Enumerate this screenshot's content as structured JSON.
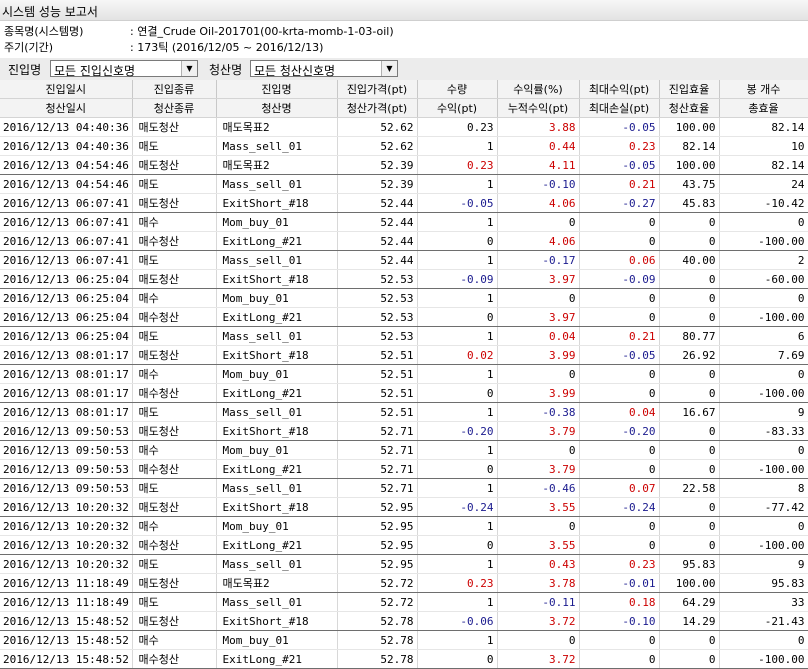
{
  "window": {
    "title": "시스템 성능 보고서"
  },
  "info": {
    "symbol_label": "종목명(시스템명)",
    "symbol_value": ": 연결_Crude Oil-201701(00-krta-momb-1-03-oil)",
    "period_label": "주기(기간)",
    "period_value": ": 173틱 (2016/12/05 ~ 2016/12/13)"
  },
  "filters": {
    "entry_label": "진입명",
    "entry_value": "모든 진입신호명",
    "exit_label": "청산명",
    "exit_value": "모든 청산신호명"
  },
  "colors": {
    "profit": "#cc0000",
    "loss": "#1a1a8e"
  },
  "columns": {
    "row1": [
      "진입일시",
      "진입종류",
      "진입명",
      "진입가격(pt)",
      "수량",
      "수익률(%)",
      "최대수익(pt)",
      "진입효율",
      "봉 개수"
    ],
    "row2": [
      "청산일시",
      "청산종류",
      "청산명",
      "청산가격(pt)",
      "수익(pt)",
      "누적수익(pt)",
      "최대손실(pt)",
      "청산효율",
      "총효율"
    ]
  },
  "rows": [
    {
      "d": "2016/12/13 04:40:36",
      "t": "매도청산",
      "n": "매도목표2",
      "p": "52.62",
      "q": "0.23",
      "r": "3.88",
      "m": "-0.05",
      "e": "100.00",
      "b": "82.14"
    },
    {
      "d": "2016/12/13 04:40:36",
      "t": "매도",
      "n": "Mass_sell_01",
      "p": "52.62",
      "q": "1",
      "r": "0.44",
      "m": "0.23",
      "e": "82.14",
      "b": "10"
    },
    {
      "d": "2016/12/13 04:54:46",
      "t": "매도청산",
      "n": "매도목표2",
      "p": "52.39",
      "q": "0.23",
      "r": "4.11",
      "m": "-0.05",
      "e": "100.00",
      "b": "82.14",
      "end": true
    },
    {
      "d": "2016/12/13 04:54:46",
      "t": "매도",
      "n": "Mass_sell_01",
      "p": "52.39",
      "q": "1",
      "r": "-0.10",
      "m": "0.21",
      "e": "43.75",
      "b": "24"
    },
    {
      "d": "2016/12/13 06:07:41",
      "t": "매도청산",
      "n": "ExitShort_#18",
      "p": "52.44",
      "q": "-0.05",
      "r": "4.06",
      "m": "-0.27",
      "e": "45.83",
      "b": "-10.42",
      "end": true
    },
    {
      "d": "2016/12/13 06:07:41",
      "t": "매수",
      "n": "Mom_buy_01",
      "p": "52.44",
      "q": "1",
      "r": "0",
      "m": "0",
      "e": "0",
      "b": "0"
    },
    {
      "d": "2016/12/13 06:07:41",
      "t": "매수청산",
      "n": "ExitLong_#21",
      "p": "52.44",
      "q": "0",
      "r": "4.06",
      "m": "0",
      "e": "0",
      "b": "-100.00",
      "end": true
    },
    {
      "d": "2016/12/13 06:07:41",
      "t": "매도",
      "n": "Mass_sell_01",
      "p": "52.44",
      "q": "1",
      "r": "-0.17",
      "m": "0.06",
      "e": "40.00",
      "b": "2"
    },
    {
      "d": "2016/12/13 06:25:04",
      "t": "매도청산",
      "n": "ExitShort_#18",
      "p": "52.53",
      "q": "-0.09",
      "r": "3.97",
      "m": "-0.09",
      "e": "0",
      "b": "-60.00",
      "end": true
    },
    {
      "d": "2016/12/13 06:25:04",
      "t": "매수",
      "n": "Mom_buy_01",
      "p": "52.53",
      "q": "1",
      "r": "0",
      "m": "0",
      "e": "0",
      "b": "0"
    },
    {
      "d": "2016/12/13 06:25:04",
      "t": "매수청산",
      "n": "ExitLong_#21",
      "p": "52.53",
      "q": "0",
      "r": "3.97",
      "m": "0",
      "e": "0",
      "b": "-100.00",
      "end": true
    },
    {
      "d": "2016/12/13 06:25:04",
      "t": "매도",
      "n": "Mass_sell_01",
      "p": "52.53",
      "q": "1",
      "r": "0.04",
      "m": "0.21",
      "e": "80.77",
      "b": "6"
    },
    {
      "d": "2016/12/13 08:01:17",
      "t": "매도청산",
      "n": "ExitShort_#18",
      "p": "52.51",
      "q": "0.02",
      "r": "3.99",
      "m": "-0.05",
      "e": "26.92",
      "b": "7.69",
      "end": true
    },
    {
      "d": "2016/12/13 08:01:17",
      "t": "매수",
      "n": "Mom_buy_01",
      "p": "52.51",
      "q": "1",
      "r": "0",
      "m": "0",
      "e": "0",
      "b": "0"
    },
    {
      "d": "2016/12/13 08:01:17",
      "t": "매수청산",
      "n": "ExitLong_#21",
      "p": "52.51",
      "q": "0",
      "r": "3.99",
      "m": "0",
      "e": "0",
      "b": "-100.00",
      "end": true
    },
    {
      "d": "2016/12/13 08:01:17",
      "t": "매도",
      "n": "Mass_sell_01",
      "p": "52.51",
      "q": "1",
      "r": "-0.38",
      "m": "0.04",
      "e": "16.67",
      "b": "9"
    },
    {
      "d": "2016/12/13 09:50:53",
      "t": "매도청산",
      "n": "ExitShort_#18",
      "p": "52.71",
      "q": "-0.20",
      "r": "3.79",
      "m": "-0.20",
      "e": "0",
      "b": "-83.33",
      "end": true
    },
    {
      "d": "2016/12/13 09:50:53",
      "t": "매수",
      "n": "Mom_buy_01",
      "p": "52.71",
      "q": "1",
      "r": "0",
      "m": "0",
      "e": "0",
      "b": "0"
    },
    {
      "d": "2016/12/13 09:50:53",
      "t": "매수청산",
      "n": "ExitLong_#21",
      "p": "52.71",
      "q": "0",
      "r": "3.79",
      "m": "0",
      "e": "0",
      "b": "-100.00",
      "end": true
    },
    {
      "d": "2016/12/13 09:50:53",
      "t": "매도",
      "n": "Mass_sell_01",
      "p": "52.71",
      "q": "1",
      "r": "-0.46",
      "m": "0.07",
      "e": "22.58",
      "b": "8"
    },
    {
      "d": "2016/12/13 10:20:32",
      "t": "매도청산",
      "n": "ExitShort_#18",
      "p": "52.95",
      "q": "-0.24",
      "r": "3.55",
      "m": "-0.24",
      "e": "0",
      "b": "-77.42",
      "end": true
    },
    {
      "d": "2016/12/13 10:20:32",
      "t": "매수",
      "n": "Mom_buy_01",
      "p": "52.95",
      "q": "1",
      "r": "0",
      "m": "0",
      "e": "0",
      "b": "0"
    },
    {
      "d": "2016/12/13 10:20:32",
      "t": "매수청산",
      "n": "ExitLong_#21",
      "p": "52.95",
      "q": "0",
      "r": "3.55",
      "m": "0",
      "e": "0",
      "b": "-100.00",
      "end": true
    },
    {
      "d": "2016/12/13 10:20:32",
      "t": "매도",
      "n": "Mass_sell_01",
      "p": "52.95",
      "q": "1",
      "r": "0.43",
      "m": "0.23",
      "e": "95.83",
      "b": "9"
    },
    {
      "d": "2016/12/13 11:18:49",
      "t": "매도청산",
      "n": "매도목표2",
      "p": "52.72",
      "q": "0.23",
      "r": "3.78",
      "m": "-0.01",
      "e": "100.00",
      "b": "95.83",
      "end": true
    },
    {
      "d": "2016/12/13 11:18:49",
      "t": "매도",
      "n": "Mass_sell_01",
      "p": "52.72",
      "q": "1",
      "r": "-0.11",
      "m": "0.18",
      "e": "64.29",
      "b": "33"
    },
    {
      "d": "2016/12/13 15:48:52",
      "t": "매도청산",
      "n": "ExitShort_#18",
      "p": "52.78",
      "q": "-0.06",
      "r": "3.72",
      "m": "-0.10",
      "e": "14.29",
      "b": "-21.43",
      "end": true
    },
    {
      "d": "2016/12/13 15:48:52",
      "t": "매수",
      "n": "Mom_buy_01",
      "p": "52.78",
      "q": "1",
      "r": "0",
      "m": "0",
      "e": "0",
      "b": "0"
    },
    {
      "d": "2016/12/13 15:48:52",
      "t": "매수청산",
      "n": "ExitLong_#21",
      "p": "52.78",
      "q": "0",
      "r": "3.72",
      "m": "0",
      "e": "0",
      "b": "-100.00",
      "end": true
    }
  ]
}
